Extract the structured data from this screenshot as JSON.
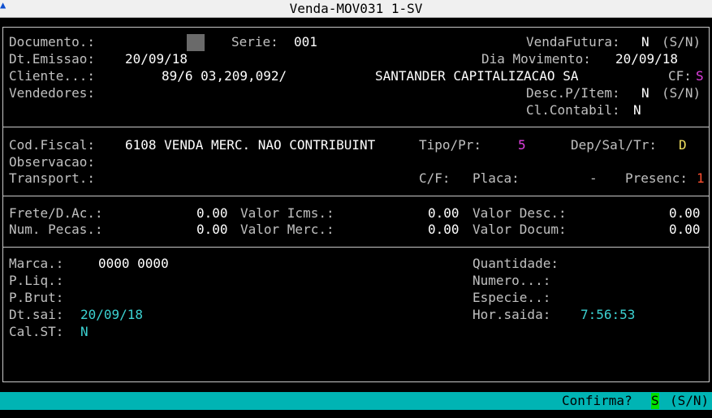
{
  "window": {
    "title": "Venda-MOV031 1-SV",
    "icon": "terminal-icon"
  },
  "header": {
    "documento_label": "Documento.:",
    "serie_label": "Serie:",
    "serie_value": "001",
    "venda_futura_label": "VendaFutura:",
    "venda_futura_value": "N",
    "venda_futura_options": "(S/N)",
    "dt_emissao_label": "Dt.Emissao:",
    "dt_emissao_value": "20/09/18",
    "dia_movimento_label": "Dia Movimento:",
    "dia_movimento_value": "20/09/18",
    "cliente_label": "Cliente...:",
    "cliente_code": "89/6 03,209,092/",
    "cliente_name": "SANTANDER CAPITALIZACAO SA",
    "cf_label": "CF:",
    "cf_value": "S",
    "vendedores_label": "Vendedores:",
    "desc_item_label": "Desc.P/Item:",
    "desc_item_value": "N",
    "desc_item_options": "(S/N)",
    "cl_contabil_label": "Cl.Contabil:",
    "cl_contabil_value": "N"
  },
  "fiscal": {
    "cod_fiscal_label": "Cod.Fiscal:",
    "cod_fiscal_value": "6108 VENDA MERC. NAO CONTRIBUINT",
    "tipo_label": "Tipo/Pr:",
    "tipo_value": "5",
    "dep_label": "Dep/Sal/Tr:",
    "dep_value": "D",
    "observacao_label": "Observacao:",
    "transport_label": "Transport.:",
    "cf_label": "C/F:",
    "placa_label": "Placa:",
    "placa_value": "-",
    "presenc_label": "Presenc:",
    "presenc_value": "1"
  },
  "totals": {
    "frete_label": "Frete/D.Ac.:",
    "frete_value": "0.00",
    "valor_icms_label": "Valor Icms.:",
    "valor_icms_value": "0.00",
    "valor_desc_label": "Valor Desc.:",
    "valor_desc_value": "0.00",
    "num_pecas_label": "Num. Pecas.:",
    "num_pecas_value": "0.00",
    "valor_merc_label": "Valor Merc.:",
    "valor_merc_value": "0.00",
    "valor_docum_label": "Valor Docum:",
    "valor_docum_value": "0.00"
  },
  "shipping": {
    "marca_label": "Marca.:",
    "marca_value": "0000 0000",
    "quantidade_label": "Quantidade:",
    "pliq_label": "P.Liq.:",
    "numero_label": "Numero...:",
    "pbrut_label": "P.Brut:",
    "especie_label": "Especie..:",
    "dtsai_label": "Dt.sai:",
    "dtsai_value": "20/09/18",
    "hor_saida_label": "Hor.saida:",
    "hor_saida_value": "7:56:53",
    "cal_st_label": "Cal.ST:",
    "cal_st_value": "N"
  },
  "status": {
    "prompt_label": "Confirma?",
    "value": "S",
    "options": "(S/N)"
  },
  "colors": {
    "background": "#000000",
    "label": "#c0c0c0",
    "value": "#ffffff",
    "cyan": "#3cd2d2",
    "magenta": "#e040e0",
    "yellow": "#f0e060",
    "red": "#ff5030",
    "status_bar": "#00b4b4",
    "confirm_highlight": "#00e000"
  }
}
